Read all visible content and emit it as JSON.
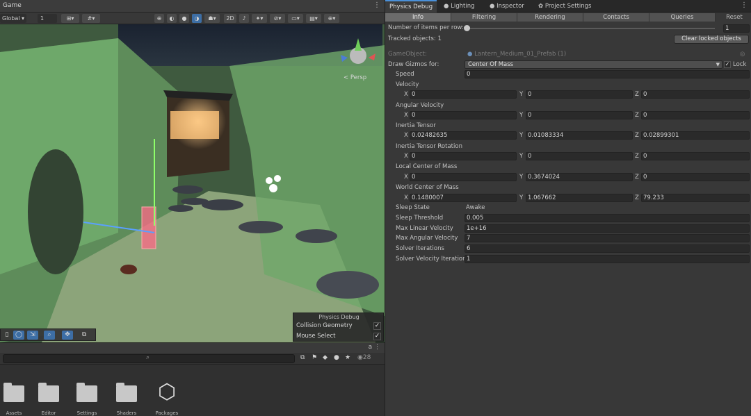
{
  "game_panel": {
    "title": "Game",
    "toolbar": {
      "space": "Global ▾",
      "num": "1",
      "btn_2d": "2D"
    },
    "scene": {
      "persp_label": "< Persp"
    },
    "physics_overlay": {
      "header": "Physics Debug",
      "rows": [
        {
          "label": "Collision Geometry",
          "checked": true
        },
        {
          "label": "Mouse Select",
          "checked": true
        }
      ]
    },
    "project": {
      "count": "28",
      "folders": [
        "Assets",
        "Editor",
        "Settings",
        "Shaders",
        "Packages"
      ]
    }
  },
  "tabs": [
    {
      "label": "Physics Debug",
      "active": true
    },
    {
      "label": "Lighting",
      "icon": "bulb-icon"
    },
    {
      "label": "Inspector",
      "icon": "info-icon"
    },
    {
      "label": "Project Settings",
      "icon": "gear-icon"
    }
  ],
  "subtabs": [
    {
      "label": "Info",
      "active": true
    },
    {
      "label": "Filtering"
    },
    {
      "label": "Rendering"
    },
    {
      "label": "Contacts"
    },
    {
      "label": "Queries"
    }
  ],
  "reset_label": "Reset",
  "items_per_row": {
    "label": "Number of items per row:",
    "value": "1"
  },
  "tracked": {
    "label": "Tracked objects: 1"
  },
  "clear_label": "Clear locked objects",
  "gameobject": {
    "label": "GameObject:",
    "value": "Lantern_Medium_01_Prefab (1)"
  },
  "draw_gizmos": {
    "label": "Draw Gizmos for:",
    "value": "Center Of Mass",
    "lock_label": "Lock"
  },
  "speed": {
    "label": "Speed",
    "value": "0"
  },
  "velocity": {
    "label": "Velocity",
    "x": "0",
    "y": "0",
    "z": "0"
  },
  "angular_velocity": {
    "label": "Angular Velocity",
    "x": "0",
    "y": "0",
    "z": "0"
  },
  "inertia_tensor": {
    "label": "Inertia Tensor",
    "x": "0.02482635",
    "y": "0.01083334",
    "z": "0.02899301"
  },
  "inertia_rotation": {
    "label": "Inertia Tensor Rotation",
    "x": "0",
    "y": "0",
    "z": "0"
  },
  "local_com": {
    "label": "Local Center of Mass",
    "x": "0",
    "y": "0.3674024",
    "z": "0"
  },
  "world_com": {
    "label": "World Center of Mass",
    "x": "0.1480007",
    "y": "1.067662",
    "z": "79.233"
  },
  "props": [
    {
      "label": "Sleep State",
      "value": "Awake",
      "plain": true
    },
    {
      "label": "Sleep Threshold",
      "value": "0.005"
    },
    {
      "label": "Max Linear Velocity",
      "value": "1e+16"
    },
    {
      "label": "Max Angular Velocity",
      "value": "7"
    },
    {
      "label": "Solver Iterations",
      "value": "6"
    },
    {
      "label": "Solver Velocity Iteration",
      "value": "1"
    }
  ],
  "axis_labels": {
    "x": "X",
    "y": "Y",
    "z": "Z"
  },
  "colors": {
    "accent": "#4a90d9",
    "collider_green": "#7fd67f"
  }
}
